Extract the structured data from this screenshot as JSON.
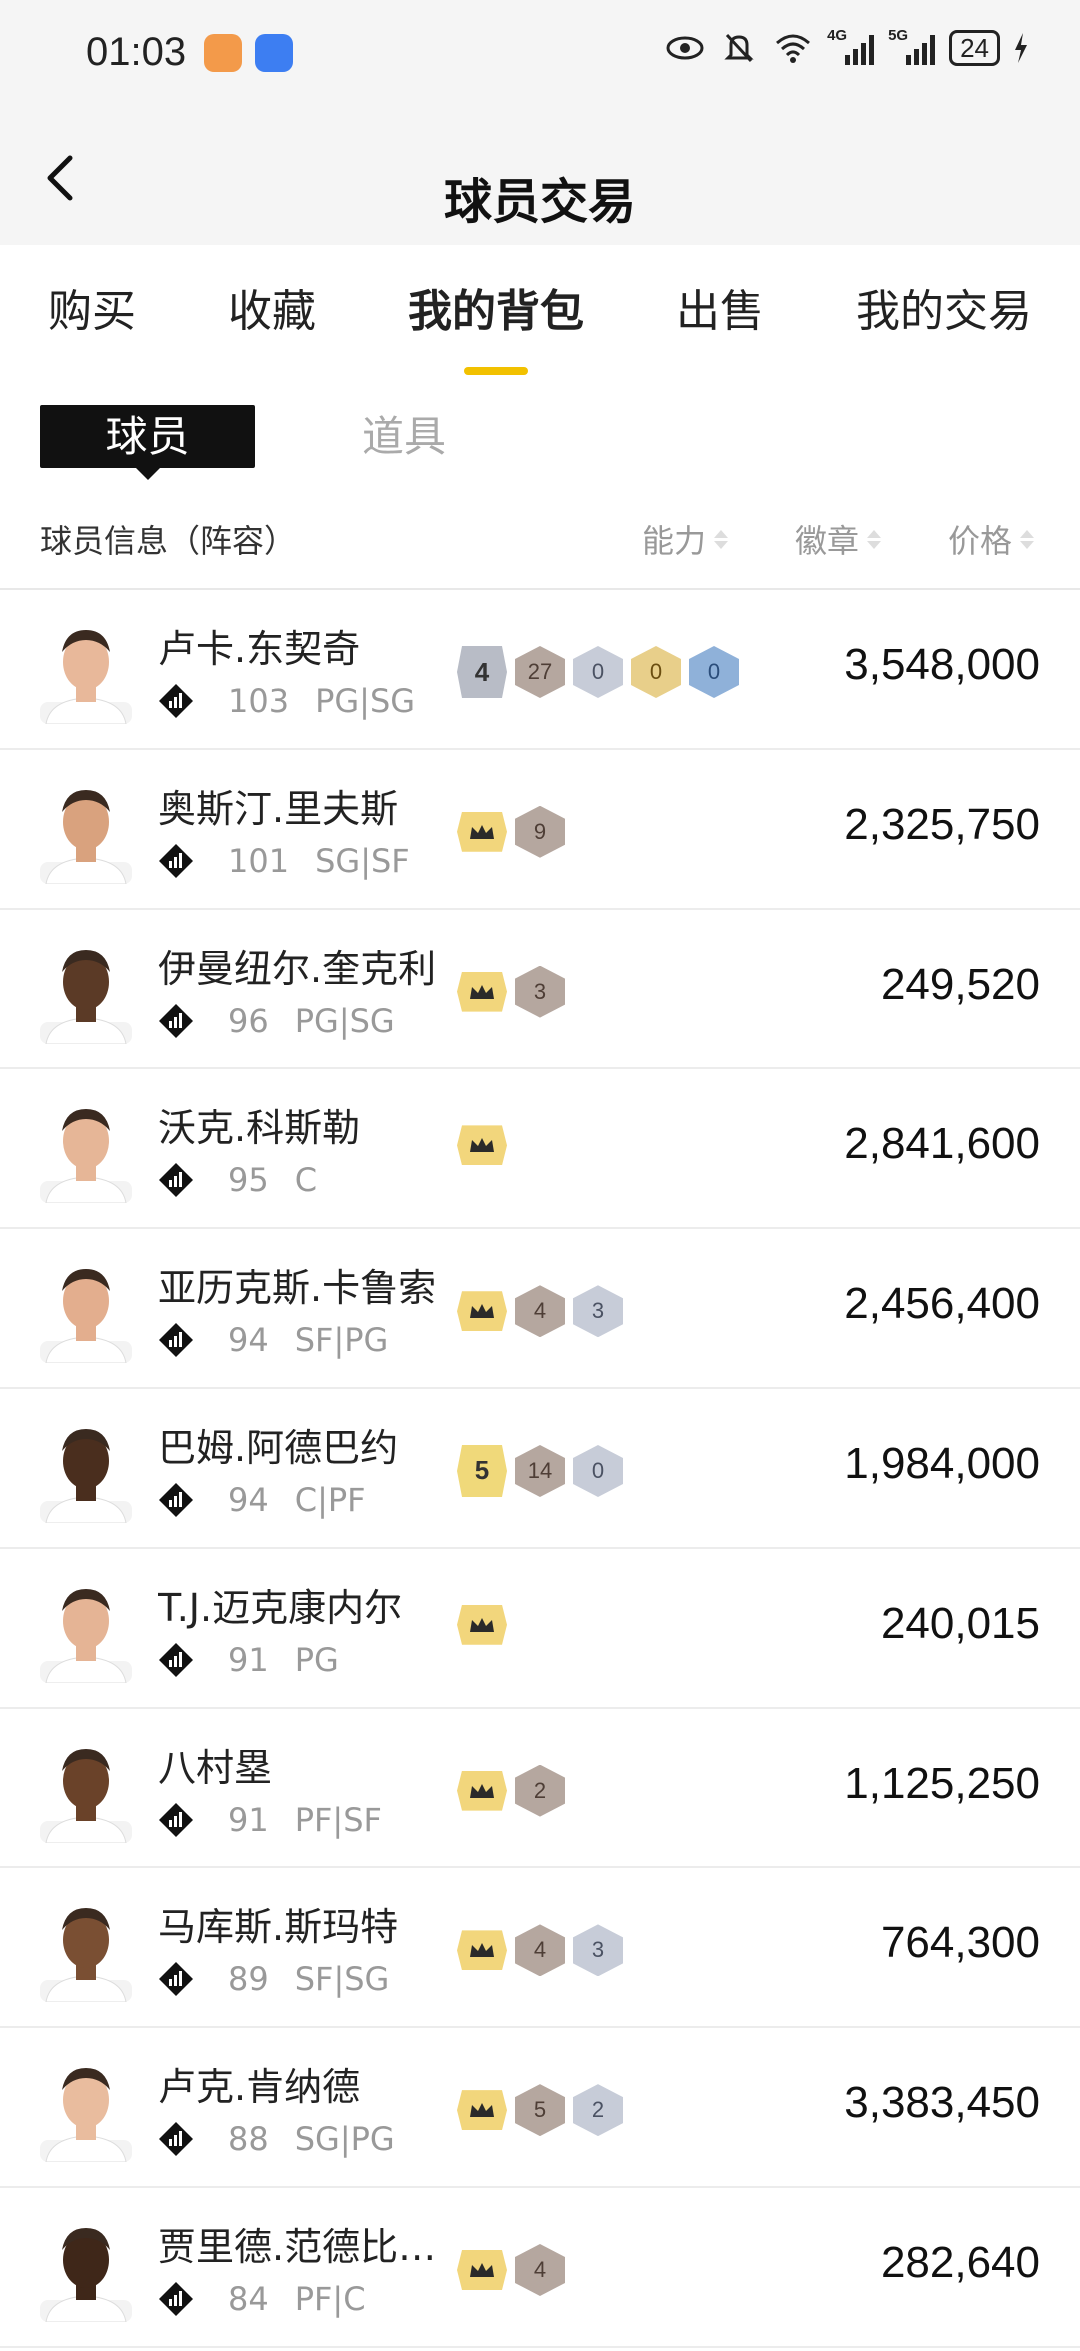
{
  "status_bar": {
    "time": "01:03",
    "net1": "4G",
    "net2": "5G",
    "battery": "24"
  },
  "header": {
    "title": "球员交易"
  },
  "tabs": [
    {
      "label": "购买"
    },
    {
      "label": "收藏"
    },
    {
      "label": "我的背包"
    },
    {
      "label": "出售"
    },
    {
      "label": "我的交易"
    }
  ],
  "active_tab": "我的背包",
  "subtabs": {
    "active": "球员",
    "inactive": "道具"
  },
  "list_header": {
    "info": "球员信息（阵容）",
    "ability": "能力",
    "badge": "徽章",
    "price": "价格"
  },
  "colors": {
    "accent": "#f2c100"
  },
  "players": [
    {
      "name": "卢卡.东契奇",
      "rating": "103",
      "position": "PG|SG",
      "price": "3,548,000"
    },
    {
      "name": "奥斯汀.里夫斯",
      "rating": "101",
      "position": "SG|SF",
      "price": "2,325,750"
    },
    {
      "name": "伊曼纽尔.奎克利",
      "rating": "96",
      "position": "PG|SG",
      "price": "249,520"
    },
    {
      "name": "沃克.科斯勒",
      "rating": "95",
      "position": "C",
      "price": "2,841,600"
    },
    {
      "name": "亚历克斯.卡鲁索",
      "rating": "94",
      "position": "SF|PG",
      "price": "2,456,400"
    },
    {
      "name": "巴姆.阿德巴约",
      "rating": "94",
      "position": "C|PF",
      "price": "1,984,000"
    },
    {
      "name": "T.J.迈克康内尔",
      "rating": "91",
      "position": "PG",
      "price": "240,015"
    },
    {
      "name": "八村塁",
      "rating": "91",
      "position": "PF|SF",
      "price": "1,125,250"
    },
    {
      "name": "马库斯.斯玛特",
      "rating": "89",
      "position": "SF|SG",
      "price": "764,300"
    },
    {
      "name": "卢克.肯纳德",
      "rating": "88",
      "position": "SG|PG",
      "price": "3,383,450"
    },
    {
      "name": "贾里德.范德比尔...",
      "rating": "84",
      "position": "PF|C",
      "price": "282,640"
    }
  ],
  "badges": {
    "r0": [
      "4",
      "27",
      "0",
      "0",
      "0"
    ],
    "r1": [
      "9"
    ],
    "r2": [
      "3"
    ],
    "r3": [],
    "r4": [
      "4",
      "3"
    ],
    "r5": [
      "5",
      "14",
      "0"
    ],
    "r6": [],
    "r7": [
      "2"
    ],
    "r8": [
      "4",
      "3"
    ],
    "r9": [
      "5",
      "2"
    ],
    "r10": [
      "4"
    ]
  }
}
